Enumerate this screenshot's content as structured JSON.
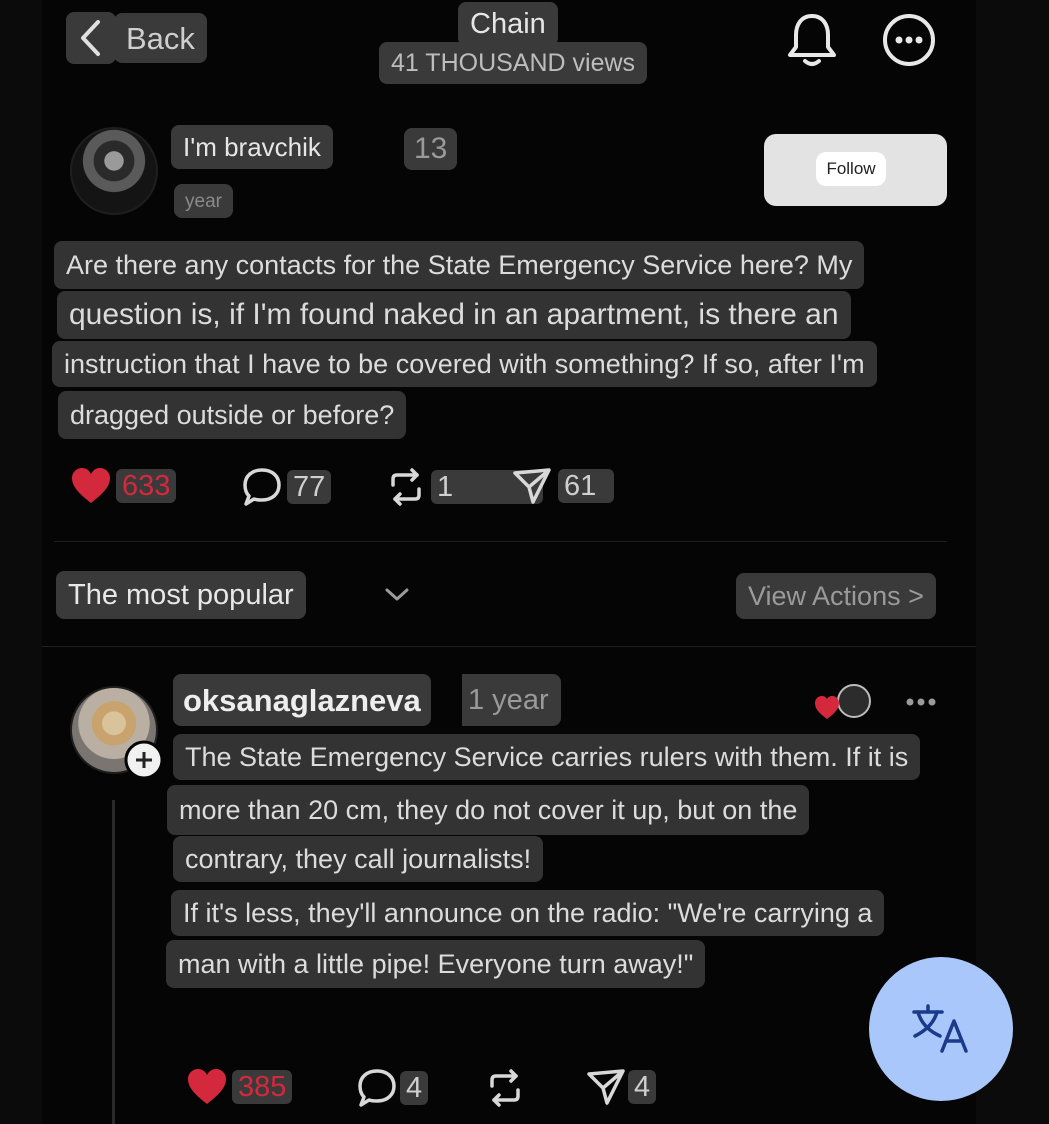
{
  "header": {
    "back_label": "Back",
    "title": "Chain",
    "views": "41 THOUSAND views"
  },
  "post": {
    "author": "I'm bravchik",
    "badge_number": "13",
    "time": "year",
    "follow_label": "Follow",
    "text_lines": [
      "Are there any contacts for the State Emergency Service here? My",
      "question is, if I'm found naked in an apartment, is there an",
      "instruction that I have to be covered with something? If so, after I'm",
      "dragged outside or before?"
    ],
    "likes": "633",
    "comments": "77",
    "reposts": "1",
    "shares": "61"
  },
  "sort": {
    "label": "The most popular",
    "view_actions": "View Actions >"
  },
  "reply": {
    "author": "oksanaglazneva",
    "time": "1 year",
    "text_lines": [
      "The State Emergency Service carries rulers with them. If it is",
      "more than 20 cm, they do not cover it up, but on the",
      "contrary, they call journalists!",
      "If it's less, they'll announce on the radio: \"We're carrying a",
      "man with a little pipe! Everyone turn away!\""
    ],
    "likes": "385",
    "comments": "4",
    "shares": "4"
  },
  "colors": {
    "heart": "#d4283d",
    "fab": "#a9c7fa",
    "chip": "#3a3a3a"
  },
  "icons": [
    "chevron-left-icon",
    "bell-icon",
    "more-circle-icon",
    "heart-icon",
    "comment-icon",
    "repost-icon",
    "send-icon",
    "chevron-down-icon",
    "plus-icon",
    "more-horizontal-icon",
    "translate-icon"
  ]
}
